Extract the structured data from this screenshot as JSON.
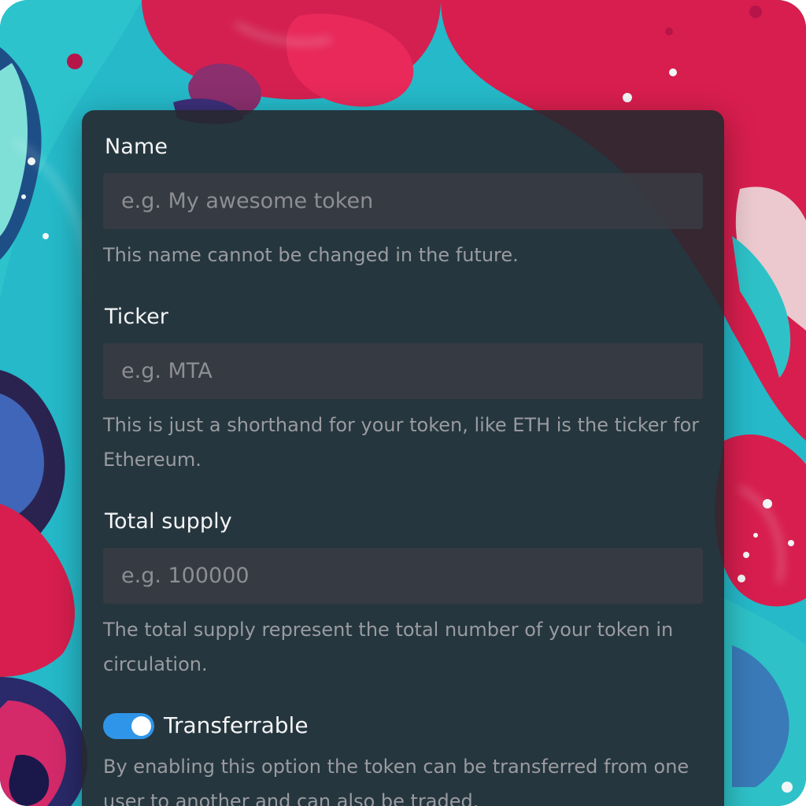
{
  "colors": {
    "accent": "#2f95e8",
    "card_bg": "#26282f",
    "input_bg": "#3a3b43",
    "label_text": "#f4f4f6",
    "help_text": "#9a9ba1",
    "bg_teal": "#25b9c9",
    "bg_red": "#d81e4e"
  },
  "form": {
    "name": {
      "label": "Name",
      "value": "",
      "placeholder": "e.g. My awesome token",
      "help": "This name cannot be changed in the future."
    },
    "ticker": {
      "label": "Ticker",
      "value": "",
      "placeholder": "e.g. MTA",
      "help": "This is just a shorthand for your token, like ETH is the ticker for Ethereum."
    },
    "supply": {
      "label": "Total supply",
      "value": "",
      "placeholder": "e.g. 100000",
      "help": "The total supply represent the total number of your token in circulation."
    },
    "transferrable": {
      "label": "Transferrable",
      "enabled": true,
      "help": "By enabling this option the token can be transferred from one user to another and can also be traded."
    }
  }
}
